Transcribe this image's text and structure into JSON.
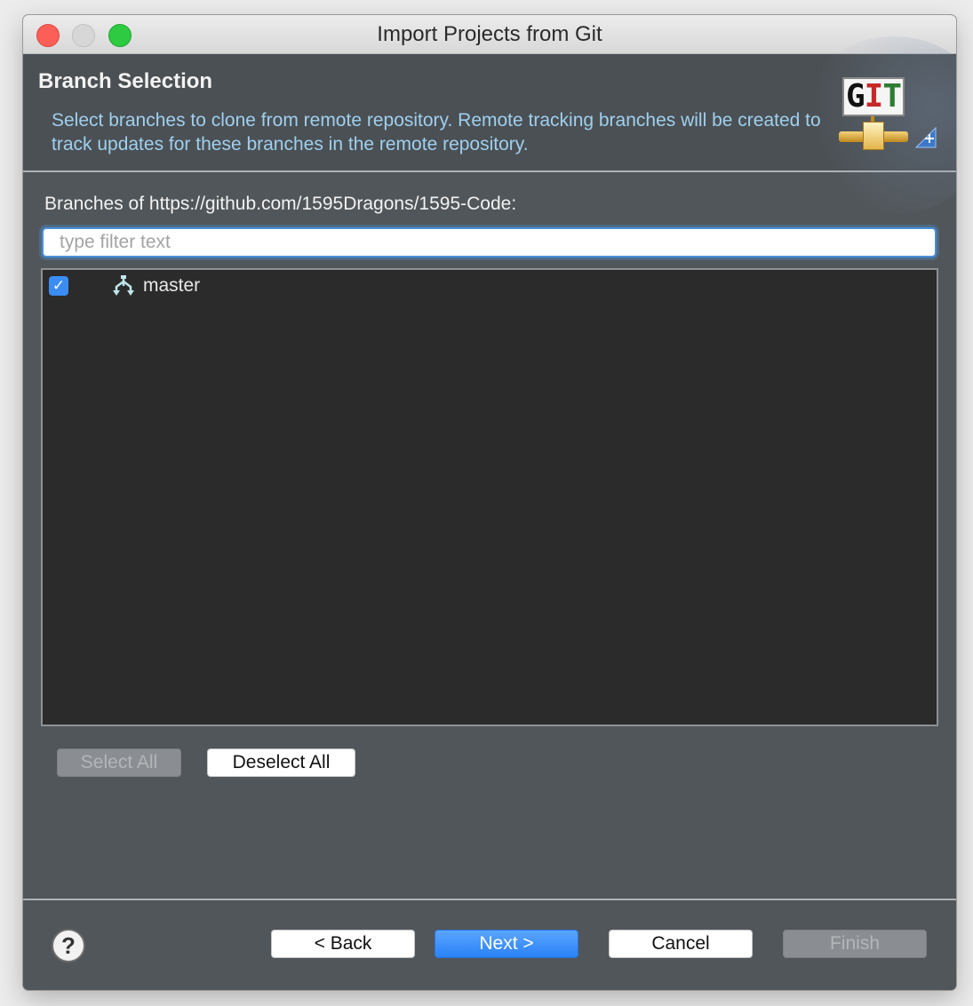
{
  "window": {
    "title": "Import Projects from Git"
  },
  "banner": {
    "title": "Branch Selection",
    "description": "Select branches to clone from remote repository. Remote tracking branches will be created to track updates for these branches in the remote repository.",
    "logo_letters": [
      "G",
      "I",
      "T"
    ]
  },
  "branches": {
    "label": "Branches of https://github.com/1595Dragons/1595-Code:",
    "filter_placeholder": "type filter text",
    "filter_value": "",
    "items": [
      {
        "name": "master",
        "checked": true,
        "icon": "branch-icon"
      }
    ]
  },
  "selection_buttons": {
    "select_all": "Select All",
    "deselect_all": "Deselect All"
  },
  "footer": {
    "help": "?",
    "back": "< Back",
    "next": "Next >",
    "cancel": "Cancel",
    "finish": "Finish"
  },
  "colors": {
    "accent": "#2a82f6",
    "panel": "#51565a",
    "list_background": "#2b2b2b",
    "description_text": "#9fd0ee"
  }
}
